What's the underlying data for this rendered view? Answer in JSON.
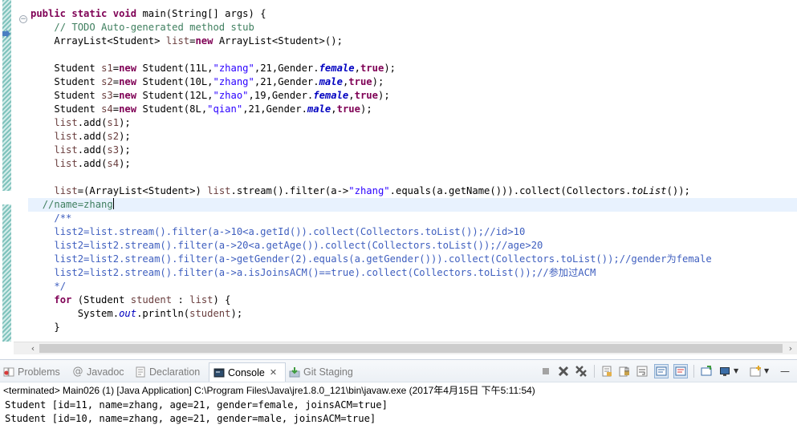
{
  "editor": {
    "lines": [
      [
        {
          "c": "kw",
          "t": "public"
        },
        {
          "c": "pln",
          "t": " "
        },
        {
          "c": "kw",
          "t": "static"
        },
        {
          "c": "pln",
          "t": " "
        },
        {
          "c": "kw",
          "t": "void"
        },
        {
          "c": "pln",
          "t": " main(String[] args) {"
        }
      ],
      [
        {
          "c": "pln",
          "t": "    "
        },
        {
          "c": "com",
          "t": "// TODO Auto-generated method stub"
        }
      ],
      [
        {
          "c": "pln",
          "t": "    ArrayList<Student> "
        },
        {
          "c": "var",
          "t": "list"
        },
        {
          "c": "pln",
          "t": "="
        },
        {
          "c": "kw",
          "t": "new"
        },
        {
          "c": "pln",
          "t": " ArrayList<Student>();"
        }
      ],
      [],
      [
        {
          "c": "pln",
          "t": "    Student "
        },
        {
          "c": "var",
          "t": "s1"
        },
        {
          "c": "pln",
          "t": "="
        },
        {
          "c": "kw",
          "t": "new"
        },
        {
          "c": "pln",
          "t": " Student(11L,"
        },
        {
          "c": "str",
          "t": "\"zhang\""
        },
        {
          "c": "pln",
          "t": ",21,Gender."
        },
        {
          "c": "fld",
          "t": "female"
        },
        {
          "c": "pln",
          "t": ","
        },
        {
          "c": "kw",
          "t": "true"
        },
        {
          "c": "pln",
          "t": ");"
        }
      ],
      [
        {
          "c": "pln",
          "t": "    Student "
        },
        {
          "c": "var",
          "t": "s2"
        },
        {
          "c": "pln",
          "t": "="
        },
        {
          "c": "kw",
          "t": "new"
        },
        {
          "c": "pln",
          "t": " Student(10L,"
        },
        {
          "c": "str",
          "t": "\"zhang\""
        },
        {
          "c": "pln",
          "t": ",21,Gender."
        },
        {
          "c": "fld",
          "t": "male"
        },
        {
          "c": "pln",
          "t": ","
        },
        {
          "c": "kw",
          "t": "true"
        },
        {
          "c": "pln",
          "t": ");"
        }
      ],
      [
        {
          "c": "pln",
          "t": "    Student "
        },
        {
          "c": "var",
          "t": "s3"
        },
        {
          "c": "pln",
          "t": "="
        },
        {
          "c": "kw",
          "t": "new"
        },
        {
          "c": "pln",
          "t": " Student(12L,"
        },
        {
          "c": "str",
          "t": "\"zhao\""
        },
        {
          "c": "pln",
          "t": ",19,Gender."
        },
        {
          "c": "fld",
          "t": "female"
        },
        {
          "c": "pln",
          "t": ","
        },
        {
          "c": "kw",
          "t": "true"
        },
        {
          "c": "pln",
          "t": ");"
        }
      ],
      [
        {
          "c": "pln",
          "t": "    Student "
        },
        {
          "c": "var",
          "t": "s4"
        },
        {
          "c": "pln",
          "t": "="
        },
        {
          "c": "kw",
          "t": "new"
        },
        {
          "c": "pln",
          "t": " Student(8L,"
        },
        {
          "c": "str",
          "t": "\"qian\""
        },
        {
          "c": "pln",
          "t": ",21,Gender."
        },
        {
          "c": "fld",
          "t": "male"
        },
        {
          "c": "pln",
          "t": ","
        },
        {
          "c": "kw",
          "t": "true"
        },
        {
          "c": "pln",
          "t": ");"
        }
      ],
      [
        {
          "c": "pln",
          "t": "    "
        },
        {
          "c": "var",
          "t": "list"
        },
        {
          "c": "pln",
          "t": ".add("
        },
        {
          "c": "var",
          "t": "s1"
        },
        {
          "c": "pln",
          "t": ");"
        }
      ],
      [
        {
          "c": "pln",
          "t": "    "
        },
        {
          "c": "var",
          "t": "list"
        },
        {
          "c": "pln",
          "t": ".add("
        },
        {
          "c": "var",
          "t": "s2"
        },
        {
          "c": "pln",
          "t": ");"
        }
      ],
      [
        {
          "c": "pln",
          "t": "    "
        },
        {
          "c": "var",
          "t": "list"
        },
        {
          "c": "pln",
          "t": ".add("
        },
        {
          "c": "var",
          "t": "s3"
        },
        {
          "c": "pln",
          "t": ");"
        }
      ],
      [
        {
          "c": "pln",
          "t": "    "
        },
        {
          "c": "var",
          "t": "list"
        },
        {
          "c": "pln",
          "t": ".add("
        },
        {
          "c": "var",
          "t": "s4"
        },
        {
          "c": "pln",
          "t": ");"
        }
      ],
      [],
      [
        {
          "c": "pln",
          "t": "    "
        },
        {
          "c": "var",
          "t": "list"
        },
        {
          "c": "pln",
          "t": "=(ArrayList<Student>) "
        },
        {
          "c": "var",
          "t": "list"
        },
        {
          "c": "pln",
          "t": ".stream().filter(a->"
        },
        {
          "c": "str",
          "t": "\"zhang\""
        },
        {
          "c": "pln",
          "t": ".equals(a.getName())).collect(Collectors."
        },
        {
          "c": "stat",
          "t": "toList"
        },
        {
          "c": "pln",
          "t": "());"
        }
      ],
      [
        {
          "c": "pln",
          "t": "  "
        },
        {
          "c": "com",
          "t": "//name=zhang"
        }
      ],
      [
        {
          "c": "pln",
          "t": "    "
        },
        {
          "c": "doc",
          "t": "/**"
        }
      ],
      [
        {
          "c": "pln",
          "t": "    "
        },
        {
          "c": "doc",
          "t": "list2=list.stream().filter(a->10<a.getId()).collect(Collectors.toList());//id>10"
        }
      ],
      [
        {
          "c": "pln",
          "t": "    "
        },
        {
          "c": "doc",
          "t": "list2=list2.stream().filter(a->20<a.getAge()).collect(Collectors.toList());//age>20"
        }
      ],
      [
        {
          "c": "pln",
          "t": "    "
        },
        {
          "c": "doc",
          "t": "list2=list2.stream().filter(a->getGender(2).equals(a.getGender())).collect(Collectors.toList());//gender为female"
        }
      ],
      [
        {
          "c": "pln",
          "t": "    "
        },
        {
          "c": "doc",
          "t": "list2=list2.stream().filter(a->a.isJoinsACM()==true).collect(Collectors.toList());//参加过ACM"
        }
      ],
      [
        {
          "c": "pln",
          "t": "    "
        },
        {
          "c": "doc",
          "t": "*/"
        }
      ],
      [
        {
          "c": "pln",
          "t": "    "
        },
        {
          "c": "kw",
          "t": "for"
        },
        {
          "c": "pln",
          "t": " (Student "
        },
        {
          "c": "var",
          "t": "student"
        },
        {
          "c": "pln",
          "t": " : "
        },
        {
          "c": "var",
          "t": "list"
        },
        {
          "c": "pln",
          "t": ") {"
        }
      ],
      [
        {
          "c": "pln",
          "t": "        System."
        },
        {
          "c": "sfld",
          "t": "out"
        },
        {
          "c": "pln",
          "t": ".println("
        },
        {
          "c": "var",
          "t": "student"
        },
        {
          "c": "pln",
          "t": ");"
        }
      ],
      [
        {
          "c": "pln",
          "t": "    }"
        }
      ],
      []
    ]
  },
  "tabs": [
    {
      "label": "Problems",
      "icon": "problems-icon"
    },
    {
      "label": "Javadoc",
      "icon": "javadoc-icon"
    },
    {
      "label": "Declaration",
      "icon": "declaration-icon"
    },
    {
      "label": "Console",
      "icon": "console-icon",
      "active": true
    },
    {
      "label": "Git Staging",
      "icon": "git-staging-icon"
    }
  ],
  "console": {
    "status": "<terminated> Main026 (1) [Java Application] C:\\Program Files\\Java\\jre1.8.0_121\\bin\\javaw.exe (2017年4月15日 下午5:11:54)",
    "output": [
      "Student [id=11, name=zhang, age=21, gender=female, joinsACM=true]",
      "Student [id=10, name=zhang, age=21, gender=male, joinsACM=true]"
    ]
  },
  "toolbar": [
    "terminate-icon",
    "remove-launch-icon",
    "remove-all-terminated-icon",
    "clear-console-icon",
    "scroll-lock-icon",
    "word-wrap-icon",
    "show-on-stdout-icon",
    "show-on-stderr-icon",
    "pin-console-icon",
    "display-selected-console-icon",
    "open-console-icon"
  ]
}
